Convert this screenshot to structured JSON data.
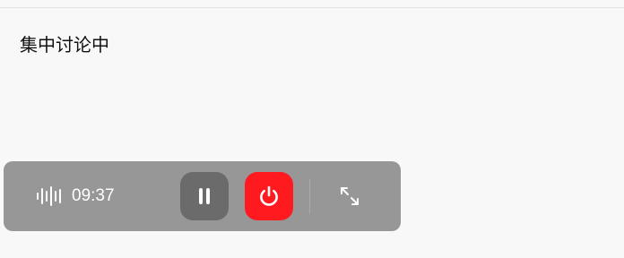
{
  "status": {
    "text": "集中讨论中"
  },
  "recorder": {
    "timer": "09:37",
    "icons": {
      "waveform": "waveform-icon",
      "pause": "pause-icon",
      "power": "power-icon",
      "expand": "expand-icon"
    },
    "colors": {
      "bar_background": "#979797",
      "pause_background": "#6b6b6b",
      "power_background": "#ff1a1f",
      "icon": "#ffffff"
    }
  }
}
